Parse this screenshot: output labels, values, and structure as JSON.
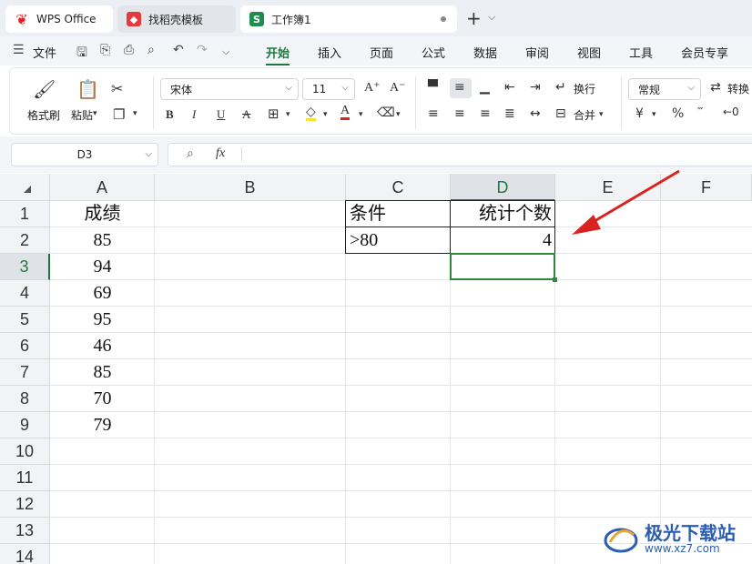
{
  "tabs": [
    {
      "label": "WPS Office",
      "icon": "wps-logo-icon"
    },
    {
      "label": "找稻壳模板",
      "icon": "daoke-logo-icon"
    },
    {
      "label": "工作簿1",
      "icon": "sheet-logo-icon",
      "logo_letter": "S"
    }
  ],
  "menu": {
    "file": "文件",
    "items": [
      "开始",
      "插入",
      "页面",
      "公式",
      "数据",
      "审阅",
      "视图",
      "工具",
      "会员专享"
    ],
    "active": "开始"
  },
  "ribbon": {
    "format_painter": "格式刷",
    "paste": "粘贴",
    "font_name": "宋体",
    "font_size": "11",
    "wrap": "换行",
    "merge": "合并",
    "number_format": "常规",
    "convert": "转换"
  },
  "formula_bar": {
    "name_box": "D3",
    "fx": "fx",
    "value": ""
  },
  "columns": [
    "A",
    "B",
    "C",
    "D",
    "E",
    "F"
  ],
  "rows": [
    "1",
    "2",
    "3",
    "4",
    "5",
    "6",
    "7",
    "8",
    "9",
    "10",
    "11",
    "12",
    "13",
    "14"
  ],
  "selected_cell": {
    "col": "D",
    "row": "3"
  },
  "cells": {
    "A1": "成绩",
    "A2": "85",
    "A3": "94",
    "A4": "69",
    "A5": "95",
    "A6": "46",
    "A7": "85",
    "A8": "70",
    "A9": "79",
    "C1": "条件",
    "C2": ">80",
    "D1": "统计个数",
    "D2": "4"
  },
  "annotation_color": "#d9231f",
  "accent_color": "#1e7a3c",
  "watermark": {
    "text": "极光下载站",
    "url": "www.xz7.com"
  }
}
